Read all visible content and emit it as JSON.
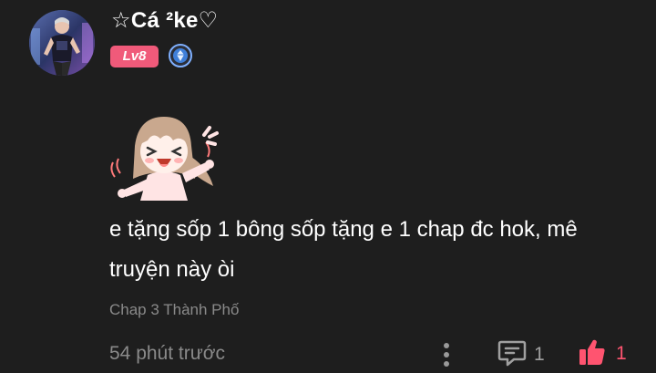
{
  "user": {
    "name": "☆Cá ²ke♡",
    "level": "Lv8",
    "avatar_icon": "user-avatar",
    "rank_icon": "diamond-rank-icon"
  },
  "comment": {
    "sticker_icon": "happy-anime-girl-sticker",
    "text": "e tặng sốp 1 bông sốp tặng e 1 chap đc hok, mê truyện này òi",
    "chapter": "Chap 3 Thành Phố",
    "timestamp": "54 phút trước"
  },
  "actions": {
    "more_icon": "more-vertical-icon",
    "reply_icon": "comment-icon",
    "reply_count": "1",
    "like_icon": "thumbs-up-icon",
    "like_count": "1"
  },
  "colors": {
    "background": "#1e1e1e",
    "level_badge": "#f05a7a",
    "rank_badge": "#3f7fd9",
    "like_active": "#ff5470",
    "muted_text": "#8a8a8a"
  }
}
